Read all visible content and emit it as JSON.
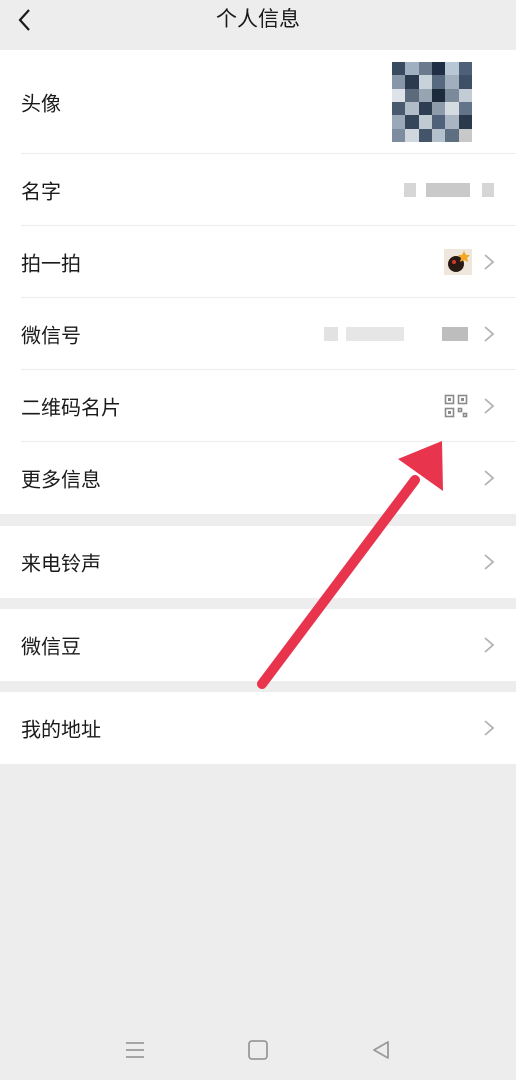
{
  "header": {
    "title": "个人信息"
  },
  "profile_rows": [
    {
      "label": "头像"
    },
    {
      "label": "名字"
    },
    {
      "label": "拍一拍"
    },
    {
      "label": "微信号"
    },
    {
      "label": "二维码名片"
    },
    {
      "label": "更多信息"
    }
  ],
  "ringtone": {
    "label": "来电铃声"
  },
  "beans": {
    "label": "微信豆"
  },
  "address": {
    "label": "我的地址"
  },
  "icons": {
    "back": "chevron-left",
    "row_arrow": "chevron-right",
    "qr": "qr-code",
    "nav_menu": "menu-lines",
    "nav_home": "square",
    "nav_back": "triangle-left"
  },
  "colors": {
    "page_bg": "#ededed",
    "card_bg": "#ffffff",
    "annotation_arrow": "#e8344d"
  }
}
